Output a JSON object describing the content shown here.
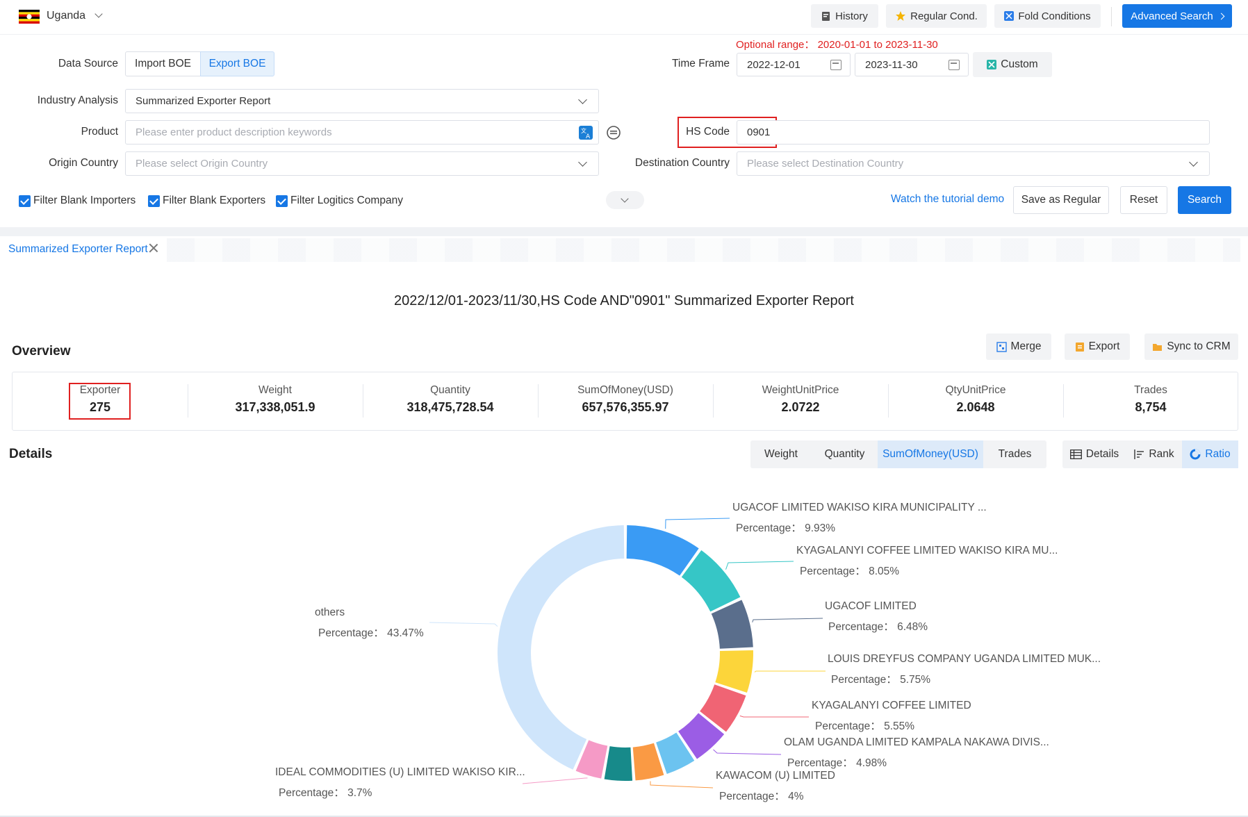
{
  "header": {
    "country": "Uganda",
    "buttons": {
      "history": "History",
      "regular_cond": "Regular Cond.",
      "fold_conditions": "Fold Conditions",
      "advanced_search": "Advanced Search"
    }
  },
  "form": {
    "optional_range": "Optional range： 2020-01-01 to 2023-11-30",
    "data_source_label": "Data Source",
    "import_boe": "Import BOE",
    "export_boe": "Export BOE",
    "time_frame_label": "Time Frame",
    "date_start": "2022-12-01",
    "date_end": "2023-11-30",
    "custom": "Custom",
    "industry_label": "Industry Analysis",
    "industry_value": "Summarized Exporter Report",
    "product_label": "Product",
    "product_placeholder": "Please enter product description keywords",
    "hs_label": "HS Code",
    "hs_value": "0901",
    "origin_label": "Origin Country",
    "origin_placeholder": "Please select Origin Country",
    "dest_label": "Destination Country",
    "dest_placeholder": "Please select Destination Country",
    "filters": [
      "Filter Blank Importers",
      "Filter Blank Exporters",
      "Filter Logitics Company"
    ],
    "tutorial": "Watch the tutorial demo",
    "save_regular": "Save as Regular",
    "reset": "Reset",
    "search": "Search"
  },
  "report": {
    "tab_label": "Summarized Exporter Report",
    "title": "2022/12/01-2023/11/30,HS Code AND\"0901\" Summarized Exporter Report",
    "overview_label": "Overview",
    "merge": "Merge",
    "export": "Export",
    "sync_crm": "Sync to CRM",
    "stats": [
      {
        "label": "Exporter",
        "value": "275"
      },
      {
        "label": "Weight",
        "value": "317,338,051.9"
      },
      {
        "label": "Quantity",
        "value": "318,475,728.54"
      },
      {
        "label": "SumOfMoney(USD)",
        "value": "657,576,355.97"
      },
      {
        "label": "WeightUnitPrice",
        "value": "2.0722"
      },
      {
        "label": "QtyUnitPrice",
        "value": "2.0648"
      },
      {
        "label": "Trades",
        "value": "8,754"
      }
    ],
    "details_label": "Details",
    "metric_tabs": [
      "Weight",
      "Quantity",
      "SumOfMoney(USD)",
      "Trades"
    ],
    "view_tabs": [
      "Details",
      "Rank",
      "Ratio"
    ],
    "percentage_prefix": "Percentage："
  },
  "chart_data": {
    "type": "pie",
    "donut": true,
    "slices": [
      {
        "name": "UGACOF LIMITED WAKISO KIRA MUNICIPALITY ...",
        "value": 9.93,
        "label": "9.93%",
        "color": "#3a9bf4"
      },
      {
        "name": "KYAGALANYI COFFEE LIMITED WAKISO KIRA MU...",
        "value": 8.05,
        "label": "8.05%",
        "color": "#36c6c6"
      },
      {
        "name": "UGACOF LIMITED",
        "value": 6.48,
        "label": "6.48%",
        "color": "#5a6e8c"
      },
      {
        "name": "LOUIS DREYFUS COMPANY UGANDA LIMITED MUK...",
        "value": 5.75,
        "label": "5.75%",
        "color": "#fcd53a"
      },
      {
        "name": "KYAGALANYI COFFEE LIMITED",
        "value": 5.55,
        "label": "5.55%",
        "color": "#f06474"
      },
      {
        "name": "OLAM UGANDA LIMITED KAMPALA NAKAWA DIVIS...",
        "value": 4.98,
        "label": "4.98%",
        "color": "#9b5de5"
      },
      {
        "name": "",
        "value": 4.2,
        "label": "",
        "color": "#6cc3f0"
      },
      {
        "name": "KAWACOM (U) LIMITED",
        "value": 4.0,
        "label": "4%",
        "color": "#fa9a44"
      },
      {
        "name": "",
        "value": 3.9,
        "label": "",
        "color": "#178a8a"
      },
      {
        "name": "IDEAL COMMODITIES (U) LIMITED WAKISO KIR...",
        "value": 3.7,
        "label": "3.7%",
        "color": "#f59ac6"
      },
      {
        "name": "others",
        "value": 43.47,
        "label": "43.47%",
        "color": "#cfe5fb"
      }
    ]
  }
}
